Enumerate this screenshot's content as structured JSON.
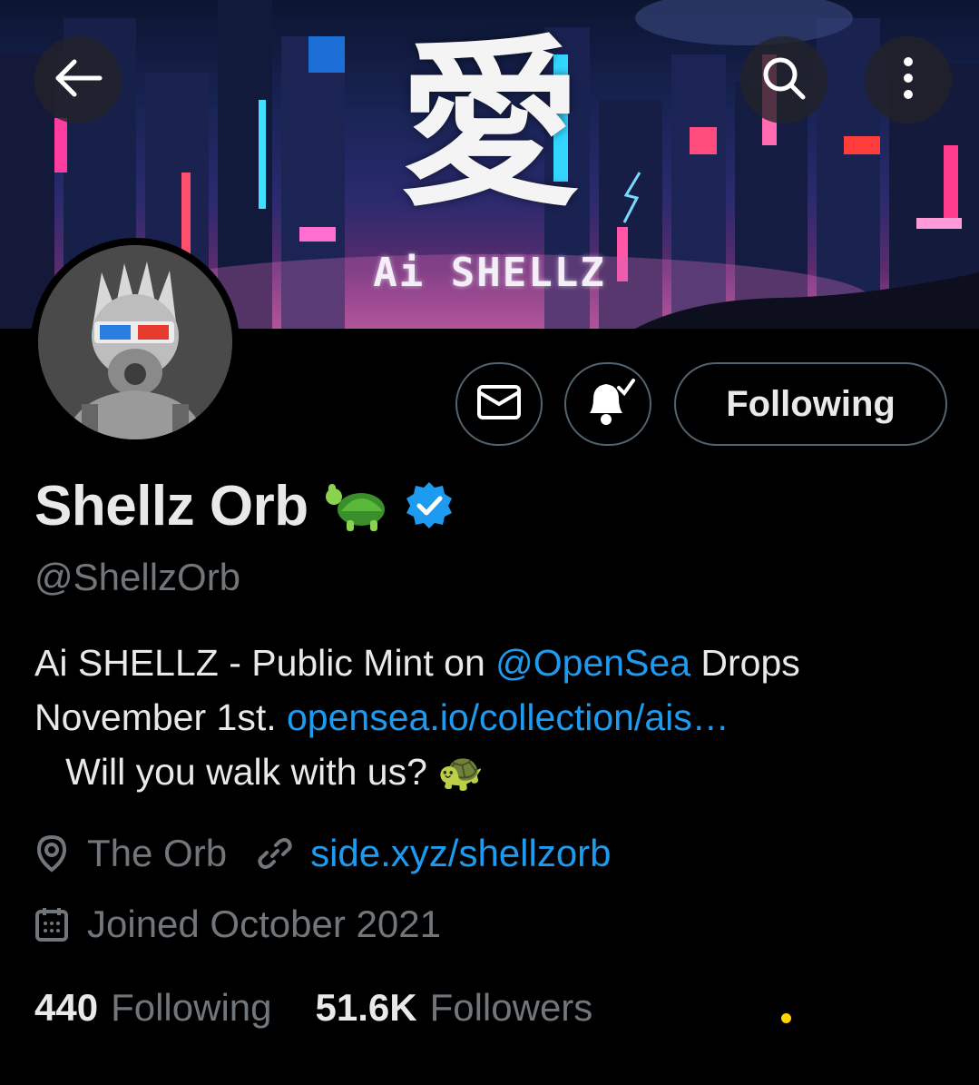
{
  "banner": {
    "kanji": "愛",
    "title": "Ai SHELLZ"
  },
  "header": {
    "back_icon": "arrow-left-icon",
    "search_icon": "search-icon",
    "more_icon": "more-vertical-icon"
  },
  "actions": {
    "mail_icon": "envelope-icon",
    "bell_icon": "bell-check-icon",
    "follow_label": "Following"
  },
  "profile": {
    "name": "Shellz Orb",
    "name_emoji": "🐢",
    "verified": true,
    "handle": "@ShellzOrb",
    "bio": {
      "part1": "Ai SHELLZ - Public Mint on ",
      "mention": "@OpenSea",
      "part2": " Drops November 1st. ",
      "link": "opensea.io/collection/ais…",
      "part3": "   Will you walk with us? ",
      "emoji": "🐢"
    },
    "location": "The Orb",
    "website": "side.xyz/shellzorb",
    "joined": "Joined October 2021"
  },
  "stats": {
    "following_count": "440",
    "following_label": "Following",
    "followers_count": "51.6K",
    "followers_label": "Followers"
  },
  "colors": {
    "background": "#000000",
    "text": "#e7e9ea",
    "muted": "#71767b",
    "link": "#1d9bf0",
    "verified": "#1d9bf0",
    "border": "#536471"
  }
}
